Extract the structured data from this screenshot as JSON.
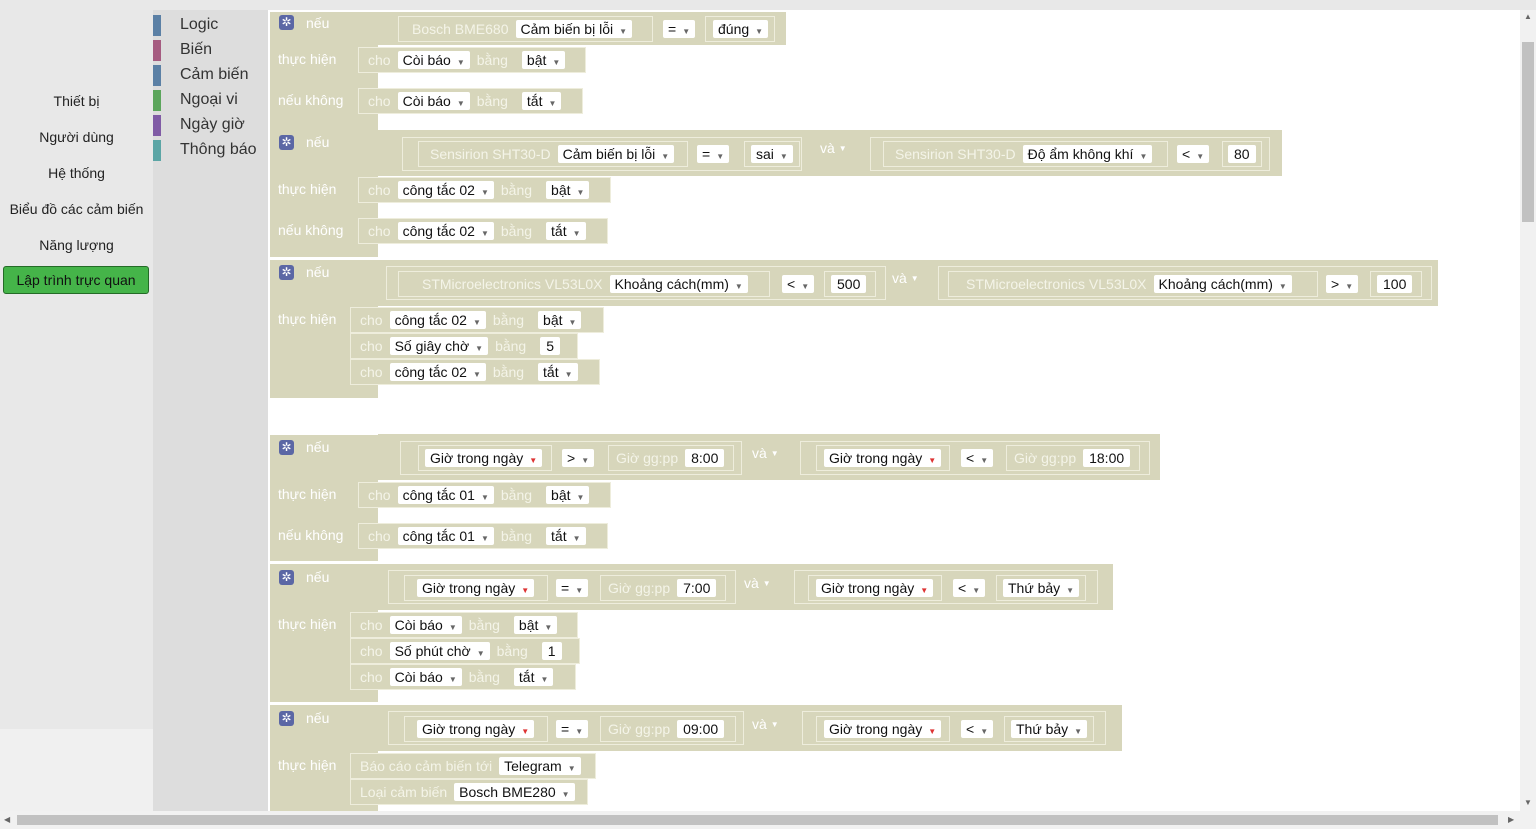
{
  "nav": {
    "items": [
      "Thiết bị",
      "Người dùng",
      "Hệ thống",
      "Biểu đồ các cảm biến",
      "Năng lượng"
    ],
    "active": "Lập trình trực quan"
  },
  "toolbox": [
    {
      "label": "Logic",
      "color": "#5b80a5"
    },
    {
      "label": "Biến",
      "color": "#a55b80"
    },
    {
      "label": "Cảm biến",
      "color": "#5b80a5"
    },
    {
      "label": "Ngoại vi",
      "color": "#5ba55b"
    },
    {
      "label": "Ngày giờ",
      "color": "#805ba5"
    },
    {
      "label": "Thông báo",
      "color": "#5ba5a5"
    }
  ],
  "kw": {
    "if": "nếu",
    "do": "thực hiện",
    "else": "nếu không",
    "set": "cho",
    "to": "bằng",
    "and": "và",
    "report": "Báo cáo cảm biến tới",
    "sensor_type": "Loại cảm biến",
    "time_label": "Giờ gg:pp"
  },
  "b1": {
    "sensor": "Bosch BME680",
    "prop": "Cảm biến bị lỗi",
    "op": "=",
    "value": "đúng",
    "do_dev": "Còi báo",
    "do_val": "bật",
    "else_dev": "Còi báo",
    "else_val": "tắt"
  },
  "b2": {
    "s1": "Sensirion SHT30-D",
    "p1": "Cảm biến bị lỗi",
    "op1": "=",
    "v1": "sai",
    "s2": "Sensirion SHT30-D",
    "p2": "Độ ẩm không khí",
    "op2": "<",
    "v2": "80",
    "do_dev": "công tắc 02",
    "do_val": "bật",
    "else_dev": "công tắc 02",
    "else_val": "tắt"
  },
  "b3": {
    "s1": "STMicroelectronics  VL53L0X",
    "p1": "Khoảng cách(mm)",
    "op1": "<",
    "v1": "500",
    "s2": "STMicroelectronics  VL53L0X",
    "p2": "Khoảng cách(mm)",
    "op2": ">",
    "v2": "100",
    "r1_dev": "công tắc 02",
    "r1_val": "bật",
    "r2_dev": "Số giây chờ",
    "r2_val": "5",
    "r3_dev": "công tắc 02",
    "r3_val": "tắt"
  },
  "b4": {
    "t1": "Giờ trong ngày",
    "op1": ">",
    "v1": "8:00",
    "t2": "Giờ trong ngày",
    "op2": "<",
    "v2": "18:00",
    "do_dev": "công tắc 01",
    "do_val": "bật",
    "else_dev": "công tắc 01",
    "else_val": "tắt"
  },
  "b5": {
    "t1": "Giờ trong ngày",
    "op1": "=",
    "v1": "7:00",
    "t2": "Giờ trong ngày",
    "op2": "<",
    "v2": "Thứ bảy",
    "r1_dev": "Còi báo",
    "r1_val": "bật",
    "r2_dev": "Số phút chờ",
    "r2_val": "1",
    "r3_dev": "Còi báo",
    "r3_val": "tắt"
  },
  "b6": {
    "t1": "Giờ trong ngày",
    "op1": "=",
    "v1": "09:00",
    "t2": "Giờ trong ngày",
    "op2": "<",
    "v2": "Thứ bảy",
    "report_target": "Telegram",
    "sensor_type": "Bosch BME280"
  }
}
